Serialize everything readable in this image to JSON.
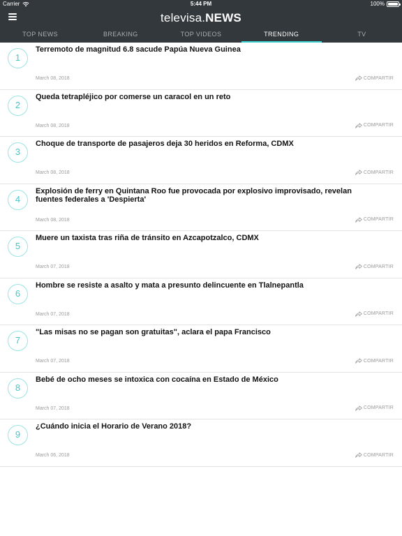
{
  "status_bar": {
    "carrier": "Carrier",
    "time": "5:44 PM",
    "battery": "100%",
    "battery_level": 1.0
  },
  "header": {
    "brand_light": "televisa.",
    "brand_bold": "NEWS"
  },
  "tabs": [
    {
      "label": "TOP NEWS",
      "active": false
    },
    {
      "label": "BREAKING",
      "active": false
    },
    {
      "label": "TOP VIDEOS",
      "active": false
    },
    {
      "label": "TRENDING",
      "active": true
    },
    {
      "label": "TV",
      "active": false
    }
  ],
  "accent_color": "#3fd0d4",
  "share_label": "COMPARTIR",
  "articles": [
    {
      "rank": "1",
      "title": "Terremoto de magnitud 6.8 sacude Papúa Nueva Guinea",
      "date": "March 08, 2018"
    },
    {
      "rank": "2",
      "title": "Queda tetrapléjico por comerse un caracol en un reto",
      "date": "March 08, 2018"
    },
    {
      "rank": "3",
      "title": "Choque de transporte de pasajeros deja 30 heridos en Reforma, CDMX",
      "date": "March 08, 2018"
    },
    {
      "rank": "4",
      "title": "Explosión de ferry en Quintana Roo fue provocada por explosivo improvisado, revelan fuentes federales a 'Despierta'",
      "date": "March 08, 2018"
    },
    {
      "rank": "5",
      "title": "Muere un taxista tras riña de tránsito en Azcapotzalco, CDMX",
      "date": "March 07, 2018"
    },
    {
      "rank": "6",
      "title": "Hombre se resiste a asalto y mata a presunto delincuente en Tlalnepantla",
      "date": "March 07, 2018"
    },
    {
      "rank": "7",
      "title": "\"Las misas no se pagan son gratuitas\", aclara el papa Francisco",
      "date": "March 07, 2018"
    },
    {
      "rank": "8",
      "title": "Bebé de ocho meses se intoxica con cocaína en Estado de México",
      "date": "March 07, 2018"
    },
    {
      "rank": "9",
      "title": "¿Cuándo inicia el Horario de Verano 2018?",
      "date": "March 06, 2018"
    }
  ]
}
